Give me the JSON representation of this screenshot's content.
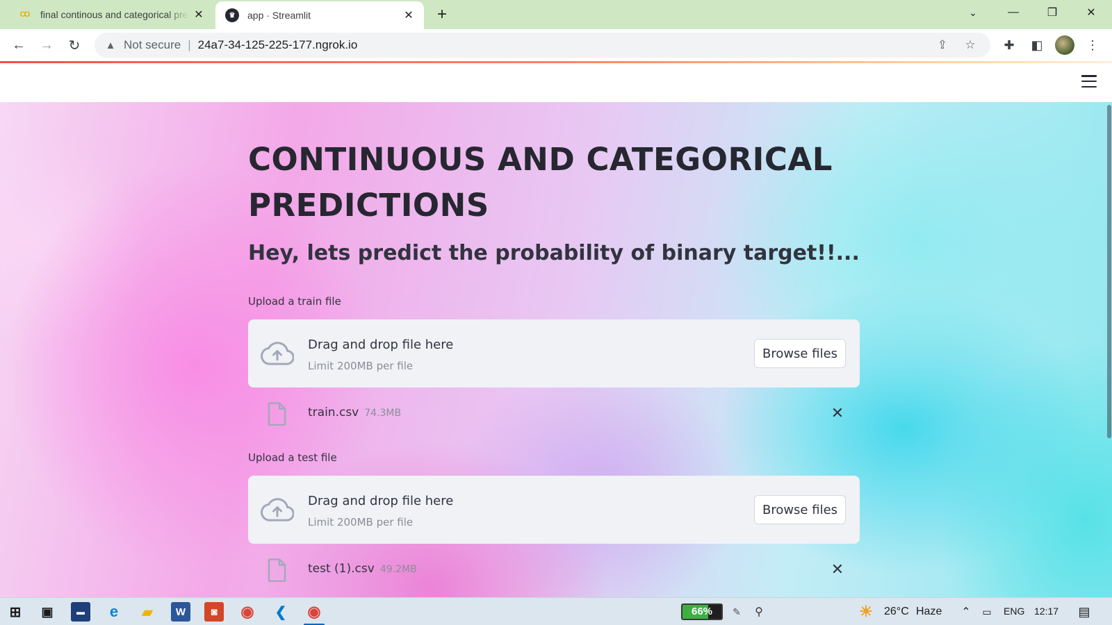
{
  "browser": {
    "tabs": [
      {
        "title": "final continous and categorical predictions",
        "favicon": "colab-icon",
        "active": false
      },
      {
        "title": "app · Streamlit",
        "favicon": "streamlit-icon",
        "active": true
      }
    ],
    "address": {
      "security_label": "Not secure",
      "url": "24a7-34-125-225-177.ngrok.io"
    }
  },
  "app": {
    "title": "CONTINUOUS AND CATEGORICAL PREDICTIONS",
    "subtitle": "Hey, lets predict the probability of binary target!!...",
    "uploaders": [
      {
        "label": "Upload a train file",
        "drop_text": "Drag and drop file here",
        "limit_text": "Limit 200MB per file",
        "button_label": "Browse files",
        "file": {
          "name": "train.csv",
          "size": "74.3MB"
        }
      },
      {
        "label": "Upload a test file",
        "drop_text": "Drag and drop file here",
        "limit_text": "Limit 200MB per file",
        "button_label": "Browse files",
        "file": {
          "name": "test (1).csv",
          "size": "49.2MB"
        }
      }
    ]
  },
  "taskbar": {
    "battery": "66%",
    "battery_level": 0.66,
    "weather": "26°C",
    "weather_desc": "Haze",
    "language": "ENG",
    "time": "12:17"
  },
  "colors": {
    "accent": "#ff4b4b",
    "tabstrip": "#cfe8c3",
    "dropzone": "#f0f2f6",
    "text": "#31333f"
  }
}
